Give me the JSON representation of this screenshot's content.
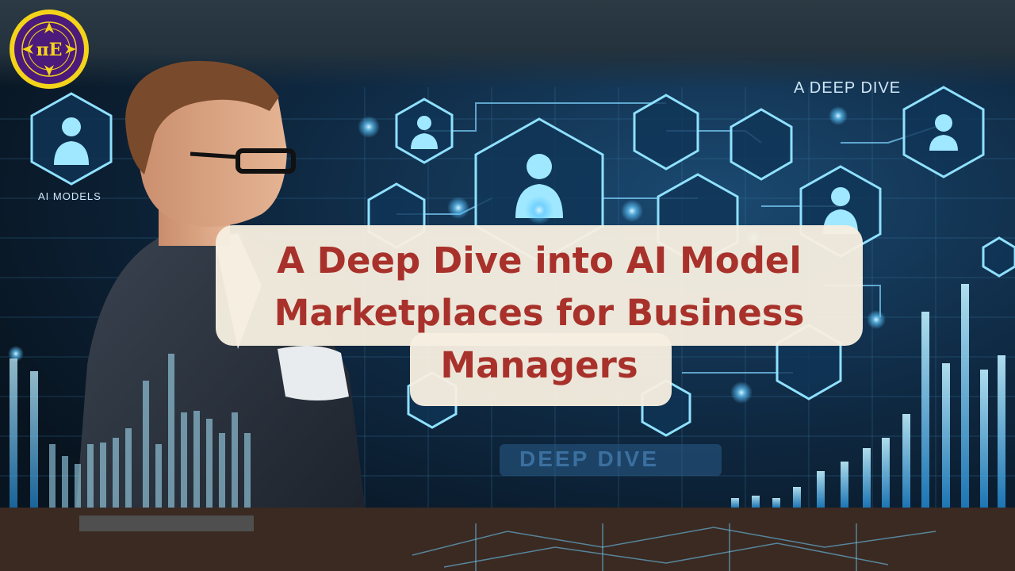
{
  "headline": {
    "line1": "A Deep Dive into AI Model",
    "line2": "Marketplaces for Business",
    "line3": "Managers"
  },
  "screen_labels": {
    "top_right": "A DEEP DIVE",
    "left_panel": "AI MODELS",
    "bottom_center": "DEEP DIVE"
  },
  "logo": {
    "glyph": "πE"
  },
  "colors": {
    "headline": "#a8322b",
    "card": "#f6eee0",
    "glow": "#5fc8ff",
    "logo_ring": "#f4d41a",
    "logo_fill": "#4b1a7a"
  }
}
